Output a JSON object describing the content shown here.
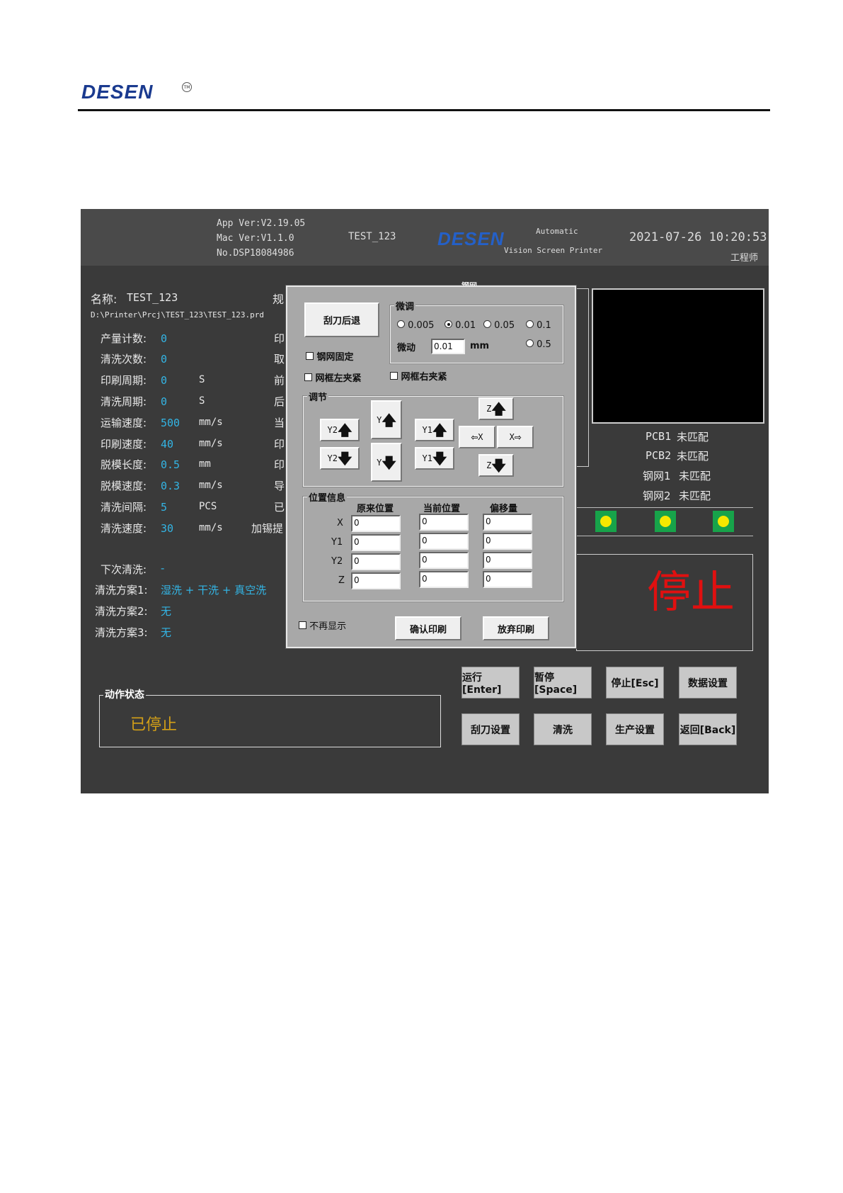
{
  "doc": {
    "logo": "DESEN",
    "logo_mark": "TM"
  },
  "header": {
    "app_ver": "App Ver:V2.19.05",
    "mac_ver": "Mac Ver:V1.1.0",
    "serial": "No.DSP18084986",
    "project": "TEST_123",
    "logo": "DESEN",
    "tagline1": "Automatic",
    "tagline2": "Vision Screen Printer",
    "datetime": "2021-07-26 10:20:53",
    "role": "工程师"
  },
  "info": {
    "name_label": "名称:",
    "name_value": "TEST_123",
    "spec_label": "规",
    "path": "D:\\Printer\\Prcj\\TEST_123\\TEST_123.prd",
    "rows": [
      {
        "label": "产量计数:",
        "value": "0",
        "unit": "",
        "right": "印"
      },
      {
        "label": "清洗次数:",
        "value": "0",
        "unit": "",
        "right": "取"
      },
      {
        "label": "印刷周期:",
        "value": "0",
        "unit": "S",
        "right": "前"
      },
      {
        "label": "清洗周期:",
        "value": "0",
        "unit": "S",
        "right": "后"
      },
      {
        "label": "运输速度:",
        "value": "500",
        "unit": "mm/s",
        "right": "当"
      },
      {
        "label": "印刷速度:",
        "value": "40",
        "unit": "mm/s",
        "right": "印"
      },
      {
        "label": "脱模长度:",
        "value": "0.5",
        "unit": "mm",
        "right": "印"
      },
      {
        "label": "脱模速度:",
        "value": "0.3",
        "unit": "mm/s",
        "right": "导"
      },
      {
        "label": "清洗间隔:",
        "value": "5",
        "unit": "PCS",
        "right": "已"
      },
      {
        "label": "清洗速度:",
        "value": "30",
        "unit": "mm/s",
        "right": "加锡提"
      }
    ],
    "next_clean_label": "下次清洗:",
    "next_clean_value": "-",
    "plans": [
      {
        "label": "清洗方案1:",
        "value": "湿洗 + 干洗 + 真空洗"
      },
      {
        "label": "清洗方案2:",
        "value": "无"
      },
      {
        "label": "清洗方案3:",
        "value": "无"
      }
    ]
  },
  "status": {
    "group_title": "动作状态",
    "text": "已停止"
  },
  "right_panel": {
    "match": [
      {
        "label": "PCB1",
        "value": "未匹配"
      },
      {
        "label": "PCB2",
        "value": "未匹配"
      },
      {
        "label": "钢网1",
        "value": "未匹配"
      },
      {
        "label": "钢网2",
        "value": "未匹配"
      }
    ],
    "big_status": "停止",
    "status_color": "#e01010",
    "led_color": "#17a34a",
    "led_dot": "#f5e800"
  },
  "buttons": {
    "run": "运行[Enter]",
    "pause": "暂停[Space]",
    "stop": "停止[Esc]",
    "data": "数据设置",
    "blade": "刮刀设置",
    "clean": "清洗",
    "production": "生产设置",
    "back": "返回[Back]"
  },
  "dialog": {
    "title_peek": "钢网",
    "blade_back": "刮刀后退",
    "fine_group": "微调",
    "steps": [
      "0.005",
      "0.01",
      "0.05",
      "0.1",
      "0.5"
    ],
    "selected_step": "0.01",
    "jog_label": "微动",
    "jog_value": "0.01",
    "jog_unit": "mm",
    "stencil_fix": "钢网固定",
    "frame_left": "网框左夹紧",
    "frame_right": "网框右夹紧",
    "adjust_group": "调节",
    "y2": "Y2",
    "y": "Y",
    "y1": "Y1",
    "z": "Z",
    "x": "X",
    "pos_group": "位置信息",
    "col_orig": "原来位置",
    "col_cur": "当前位置",
    "col_off": "偏移量",
    "pos_rows": [
      {
        "axis": "X",
        "orig": "0",
        "cur": "0",
        "off": "0"
      },
      {
        "axis": "Y1",
        "orig": "0",
        "cur": "0",
        "off": "0"
      },
      {
        "axis": "Y2",
        "orig": "0",
        "cur": "0",
        "off": "0"
      },
      {
        "axis": "Z",
        "orig": "0",
        "cur": "0",
        "off": "0"
      }
    ],
    "no_show": "不再显示",
    "confirm": "确认印刷",
    "abandon": "放弃印刷"
  }
}
